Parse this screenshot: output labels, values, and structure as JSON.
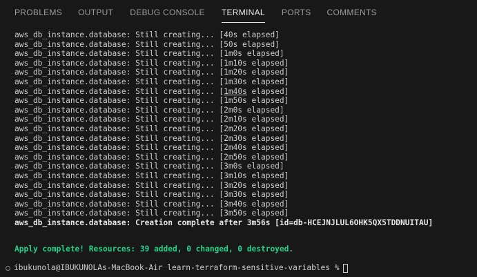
{
  "tabs": [
    {
      "label": "PROBLEMS"
    },
    {
      "label": "OUTPUT"
    },
    {
      "label": "DEBUG CONSOLE"
    },
    {
      "label": "TERMINAL",
      "active": true
    },
    {
      "label": "PORTS"
    },
    {
      "label": "COMMENTS"
    }
  ],
  "terminal": {
    "lines": [
      "aws_db_instance.database: Still creating... [40s elapsed]",
      "aws_db_instance.database: Still creating... [50s elapsed]",
      "aws_db_instance.database: Still creating... [1m0s elapsed]",
      "aws_db_instance.database: Still creating... [1m10s elapsed]",
      "aws_db_instance.database: Still creating... [1m20s elapsed]",
      "aws_db_instance.database: Still creating... [1m30s elapsed]",
      {
        "prefix": "aws_db_instance.database: Still creating... [",
        "underlined": "1m40s",
        "suffix": " elapsed]"
      },
      "aws_db_instance.database: Still creating... [1m50s elapsed]",
      "aws_db_instance.database: Still creating... [2m0s elapsed]",
      "aws_db_instance.database: Still creating... [2m10s elapsed]",
      "aws_db_instance.database: Still creating... [2m20s elapsed]",
      "aws_db_instance.database: Still creating... [2m30s elapsed]",
      "aws_db_instance.database: Still creating... [2m40s elapsed]",
      "aws_db_instance.database: Still creating... [2m50s elapsed]",
      "aws_db_instance.database: Still creating... [3m0s elapsed]",
      "aws_db_instance.database: Still creating... [3m10s elapsed]",
      "aws_db_instance.database: Still creating... [3m20s elapsed]",
      "aws_db_instance.database: Still creating... [3m30s elapsed]",
      "aws_db_instance.database: Still creating... [3m40s elapsed]",
      "aws_db_instance.database: Still creating... [3m50s elapsed]"
    ],
    "creation_complete": "aws_db_instance.database: Creation complete after 3m56s [id=db-HCEJNJLUL6OHK5QX5TDDNUITAU]",
    "apply_complete": "Apply complete! Resources: 39 added, 0 changed, 0 destroyed.",
    "prompt": "ibukunola@IBUKUNOLAs-MacBook-Air learn-terraform-sensitive-variables %"
  },
  "colors": {
    "background": "#181818",
    "text": "#cccccc",
    "active_tab": "#e7e7e7",
    "inactive_tab": "#9d9d9d",
    "success": "#23d18b"
  }
}
